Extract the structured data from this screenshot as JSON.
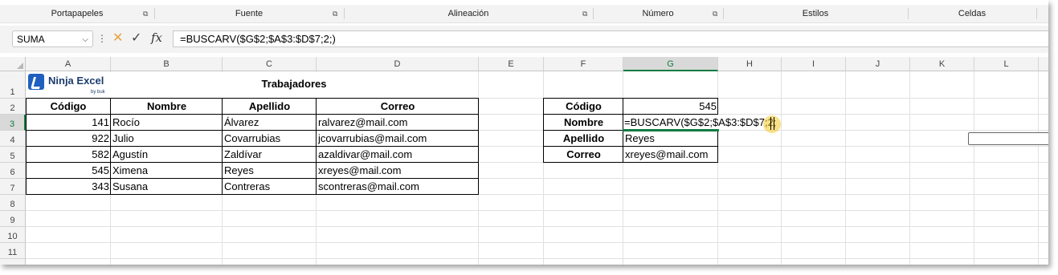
{
  "ribbon": {
    "groups": [
      "Portapapeles",
      "Fuente",
      "Alineación",
      "Número",
      "Estilos",
      "Celdas"
    ]
  },
  "formula_bar": {
    "name_box": "SUMA",
    "formula": "=BUSCARV($G$2;$A$3:$D$7;2;)",
    "fx_label": "fx"
  },
  "columns": [
    "A",
    "B",
    "C",
    "D",
    "E",
    "F",
    "G",
    "H",
    "I",
    "J",
    "K",
    "L"
  ],
  "rows": [
    "1",
    "2",
    "3",
    "4",
    "5",
    "6",
    "7",
    "8",
    "9",
    "10",
    "11"
  ],
  "logo": {
    "name": "Ninja Excel",
    "sub": "by buk"
  },
  "table": {
    "title": "Trabajadores",
    "headers": [
      "Código",
      "Nombre",
      "Apellido",
      "Correo"
    ],
    "rows": [
      [
        "141",
        "Rocío",
        "Álvarez",
        "ralvarez@mail.com"
      ],
      [
        "922",
        "Julio",
        "Covarrubias",
        "jcovarrubias@mail.com"
      ],
      [
        "582",
        "Agustín",
        "Zaldívar",
        "azaldivar@mail.com"
      ],
      [
        "545",
        "Ximena",
        "Reyes",
        "xreyes@mail.com"
      ],
      [
        "343",
        "Susana",
        "Contreras",
        "scontreras@mail.com"
      ]
    ]
  },
  "lookup": {
    "labels": [
      "Código",
      "Nombre",
      "Apellido",
      "Correo"
    ],
    "codigo_value": "545",
    "nombre_editing": "=BUSCARV($G$2;$A$3:$D$7;2;",
    "apellido_value": "Reyes",
    "correo_value": "xreyes@mail.com"
  },
  "colors": {
    "accent": "#107c41",
    "cursor_highlight": "#f5c828",
    "logo_blue": "#1f5fbf"
  }
}
